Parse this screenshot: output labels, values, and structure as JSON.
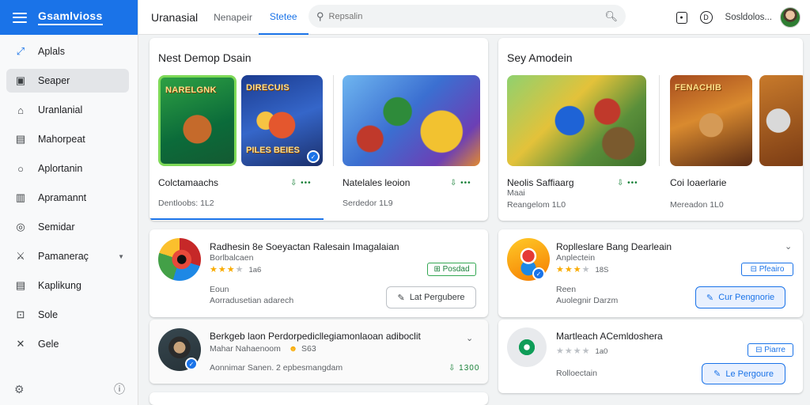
{
  "brand": {
    "title": "Gsamlvioss"
  },
  "sidebar": {
    "items": [
      {
        "label": "Aplals"
      },
      {
        "label": "Seaper"
      },
      {
        "label": "Uranlanial"
      },
      {
        "label": "Mahorpeat"
      },
      {
        "label": "Aplortanin"
      },
      {
        "label": "Apramannt"
      },
      {
        "label": "Semidar"
      },
      {
        "label": "Pamaneraç"
      },
      {
        "label": "Kaplikung"
      },
      {
        "label": "Sole"
      },
      {
        "label": "Gele"
      }
    ]
  },
  "topbar": {
    "app_title": "Uranasial",
    "tabs": [
      {
        "label": "Nenapeir"
      },
      {
        "label": "Stetee"
      }
    ],
    "search_placeholder": "Repsalin",
    "user_name": "Sosldolos..."
  },
  "featured_left": {
    "title": "Nest Demop Dsain",
    "tiles": [
      {
        "art_top": "NARELGNK",
        "art_bottom": ""
      },
      {
        "art_top": "DIRECUIS",
        "art_bottom": "PILES BEIES"
      }
    ],
    "games": [
      {
        "name": "Colctamaachs",
        "meta": "Dentloobs: 1L2"
      },
      {
        "name": "Natelales leoion",
        "meta": "Serdedor  1L9"
      }
    ]
  },
  "featured_right": {
    "title": "Sey Amodein",
    "tiles": [
      {
        "art_top": ""
      },
      {
        "art_top": "FENACHIB"
      },
      {
        "art_top": ""
      }
    ],
    "games": [
      {
        "name": "Neolis Saffiaarg",
        "extra": "Maai",
        "meta": "Reangelom  1L0"
      },
      {
        "name": "Coi Ioaerlarie",
        "meta": "Mereadon  1L0"
      }
    ]
  },
  "list_left": [
    {
      "title": "Radhesin 8e Soeyactan Ralesain Imagalaian",
      "subtitle": "Borlbalcaen",
      "rating_count": "1a6",
      "line2": "Eoun",
      "line3": "Aorradusetian adarech",
      "badge": "Posdad",
      "action": "Lat Pergubere"
    },
    {
      "title": "Berkgeb laon Perdorpedicllegiamonlaoan adiboclit",
      "line2": "Mahar Nahaenoom",
      "count": "S63",
      "line3": "Aonnimar Sanen.  2 epbesmangdam",
      "downloads": "1300"
    }
  ],
  "list_right": [
    {
      "title": "Roplleslare Bang Dearleain",
      "subtitle": "Anplectein",
      "rating_count": "18S",
      "line2": "Reen",
      "line3": "Auolegnir Darzm",
      "badge": "Pfeairo",
      "action": "Cur Pengnorie"
    },
    {
      "title": "Martleach ACemldoshera",
      "rating_count": "1a0",
      "line3": "Rolloectain",
      "badge": "Piarre",
      "action": "Le Pergoure"
    }
  ]
}
